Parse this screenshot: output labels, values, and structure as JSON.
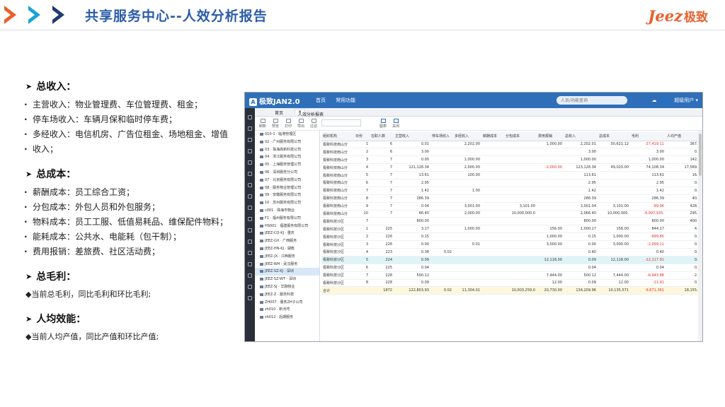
{
  "slide": {
    "title": "共享服务中心--人效分析报告",
    "brand_latin": "Jeez",
    "brand_cn": "极致"
  },
  "sections": [
    {
      "heading": "总收入：",
      "bullets": [
        "主营收入：物业管理费、车位管理费、租金；",
        "停车场收入：车辆月保和临时停车费；",
        "多经收入：电信机房、广告位租金、场地租金、增值",
        "收入；"
      ]
    },
    {
      "heading": "总成本：",
      "bullets": [
        "薪酬成本：员工综合工资；",
        "分包成本：外包人员和外包服务；",
        "物料成本：员工工服、低值易耗品、维保配件物料；",
        "能耗成本：公共水、电能耗（包干制）；",
        "费用报销：差旅费、社区活动费；"
      ]
    },
    {
      "heading": "总毛利：",
      "diamonds": [
        "◆当前总毛利，同比毛利和环比毛利;"
      ]
    },
    {
      "heading": "人均效能：",
      "diamonds": [
        "◆当前人均产值，同比产值和环比产值;"
      ]
    }
  ],
  "app": {
    "logo": "极致JAN2.0",
    "nav": [
      "首页",
      "常用功能"
    ],
    "search_placeholder": "人员/功能查询",
    "user": "超级用户",
    "tabs": {
      "home": "首页",
      "active": "人效分析报表"
    },
    "toolbar": [
      "刷新",
      "预览",
      "打印",
      "导出",
      "过滤"
    ],
    "toolbar_right": [
      "图表",
      "关闭"
    ],
    "tree": [
      "010-1 · 临港管理区",
      "02 · 广州服务有限公司",
      "03 · 珠海高新科技公司",
      "04 · 浙江服务有限公司",
      "05 · 上海服务管理公司",
      "06 · 深圳服务分公司",
      "07 · 北京服务有限公司",
      "08 · 服务物业管理公司",
      "09 · 安徽服务有限公司",
      "10 · 苏州服务有限公司",
      "c001 · 珠海市物业",
      "F1 · 福州服务有限公司",
      "HS001 · 福建服务有限公司",
      "JEEZ-CQ-KJ · 重庆",
      "JEEZ-GX · 广西服务",
      "JEEZ-HN-KJ · 湖南",
      "JEEZ-JX · 江西服务",
      "JEEZ-WH · 武汉服务",
      "JEEZ-SZ-KJ · 深圳",
      "JEEZ-SZ-WT · 深圳",
      "JEEZ-SJ · 华融物业",
      "JEEZ-Z · 服务科技",
      "ZH007 · 服务ZH子公司",
      "zh010 · 新河湾",
      "zh012 · 后期服务"
    ],
    "tree_selected_index": 18,
    "columns": [
      "组织机构",
      "日份",
      "在职人数",
      "主营收入",
      "停车场收入",
      "多经收入",
      "薪酬成本",
      "分包成本",
      "费用报销",
      "总收入",
      "总成本",
      "毛利",
      "人均产值"
    ],
    "rows": [
      [
        "极致科技南山分",
        "1",
        "6",
        "0.01",
        "",
        "2,202.00",
        "",
        "",
        "1,000.00",
        "2,202.01",
        "30,621.12",
        "-27,419.11",
        "367.00"
      ],
      [
        "极致科技南山分",
        "2",
        "6",
        "3.00",
        "",
        "",
        "",
        "",
        "",
        "3.00",
        "",
        "3.00",
        "0.50"
      ],
      [
        "极致科技南山分",
        "3",
        "7",
        "0.00",
        "",
        "1,000.00",
        "",
        "",
        "",
        "1,000.00",
        "",
        "1,000.00",
        "142.86"
      ],
      [
        "极致科技南山分",
        "4",
        "7",
        "121,128.34",
        "",
        "2,000.00",
        "",
        "",
        "-2,000.00",
        "123,128.34",
        "49,020.00",
        "74,108.34",
        "17,589.76"
      ],
      [
        "极致科技南山分",
        "5",
        "7",
        "13.61",
        "",
        "100.00",
        "",
        "",
        "",
        "113.61",
        "",
        "113.61",
        "16.23"
      ],
      [
        "极致科技南山分",
        "6",
        "7",
        "2.95",
        "",
        "",
        "",
        "",
        "",
        "2.95",
        "",
        "2.95",
        "0.42"
      ],
      [
        "极致科技南山分",
        "7",
        "7",
        "1.42",
        "",
        "1.00",
        "",
        "",
        "",
        "1.42",
        "",
        "1.42",
        "0.20"
      ],
      [
        "极致科技南山分",
        "8",
        "7",
        "286.39",
        "",
        "",
        "",
        "",
        "",
        "286.39",
        "",
        "286.39",
        "40.91"
      ],
      [
        "极致科技南山分",
        "9",
        "7",
        "0.04",
        "",
        "3,001.00",
        "",
        "3,101.00",
        "",
        "3,001.04",
        "3,101.00",
        "-99.96",
        "428.72"
      ],
      [
        "极致科技南山分",
        "10",
        "7",
        "66.40",
        "",
        "2,000.00",
        "",
        "10,000,000.0",
        "",
        "2,066.40",
        "10,000,000.",
        "-9,997,935.",
        "295.77"
      ],
      [
        "极致科技沙区",
        "7",
        "",
        "800.00",
        "",
        "",
        "",
        "",
        "",
        "800.00",
        "",
        "800.00",
        "400.00"
      ],
      [
        "极致科技沙区",
        "1",
        "225",
        "3.17",
        "",
        "1,000.00",
        "",
        "",
        "156.00",
        "1,000.17",
        "156.00",
        "844.17",
        "4.45"
      ],
      [
        "极致科技沙区",
        "2",
        "226",
        "0.15",
        "",
        "",
        "",
        "",
        "1,000.00",
        "0.15",
        "1,000.00",
        "-999.85",
        "0.00"
      ],
      [
        "极致科技沙区",
        "3",
        "226",
        "0.00",
        "",
        "0.01",
        "",
        "",
        "3,000.00",
        "0.00",
        "3,000.00",
        "-2,999.11",
        "0.00"
      ],
      [
        "极致科技沙区",
        "4",
        "223",
        "0.38",
        "0.02",
        "",
        "",
        "",
        "",
        "0.40",
        "",
        "0.40",
        "0.00"
      ],
      [
        "极致科技沙区",
        "5",
        "224",
        "0.09",
        "",
        "",
        "",
        "",
        "12,118.00",
        "0.09",
        "12,118.00",
        "-12,117.91",
        "0.00"
      ],
      [
        "极致科技沙区",
        "6",
        "225",
        "0.04",
        "",
        "",
        "",
        "",
        "",
        "0.04",
        "",
        "0.04",
        "0.00"
      ],
      [
        "极致科技沙区",
        "7",
        "228",
        "500.12",
        "",
        "",
        "",
        "",
        "7,444.00",
        "500.12",
        "7,444.00",
        "-6,943.88",
        "2.19"
      ],
      [
        "极致科技沙区",
        "8",
        "228",
        "0.09",
        "",
        "",
        "",
        "",
        "12.00",
        "0.09",
        "12.00",
        "-11.91",
        "0.00"
      ]
    ],
    "highlight_row_index": 15,
    "total": [
      "合计",
      "",
      "1872",
      "122,803.93",
      "0.02",
      "11,304.01",
      "",
      "10,003,259.0",
      "20,730.00",
      "134,209.96",
      "10,135,571",
      "-9,871,361",
      "18,155.15"
    ],
    "accent": "#2f6fba",
    "negative_color": "#e0302b"
  }
}
